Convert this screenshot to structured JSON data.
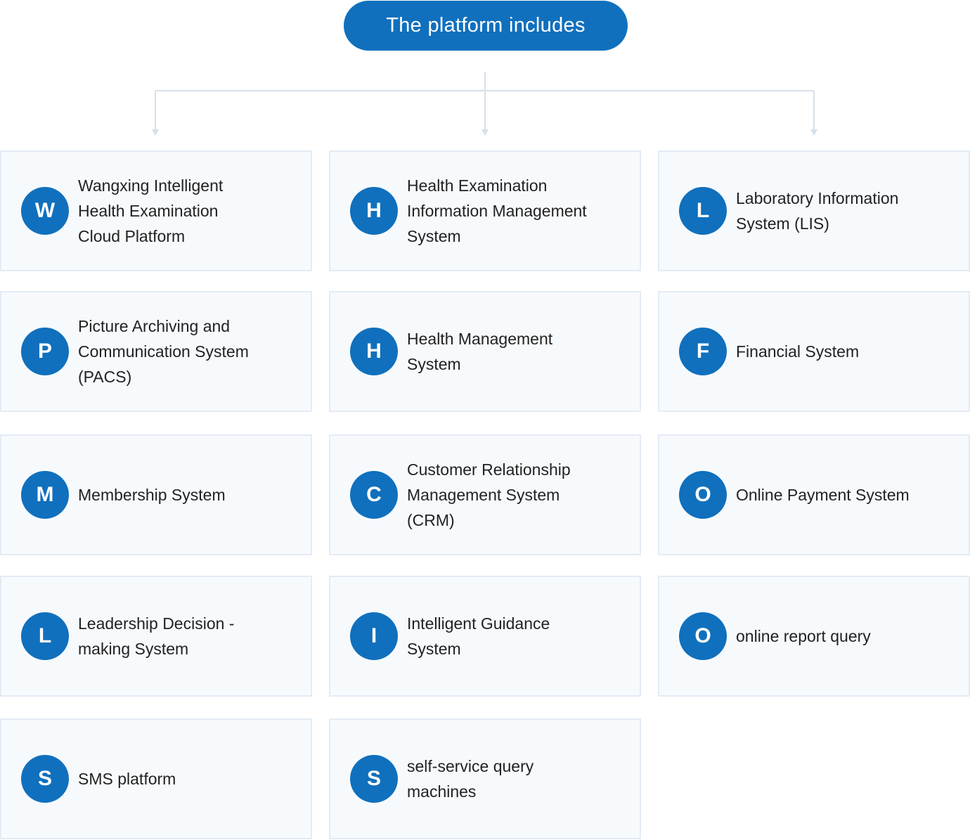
{
  "header": {
    "title": "The platform includes"
  },
  "colors": {
    "accent": "#1070bd",
    "card_bg": "#f7fafd",
    "card_border": "#e3ecf5",
    "connector": "#d5e0ea",
    "text": "#222222"
  },
  "systems": [
    {
      "initial": "W",
      "label": "Wangxing Intelligent Health Examination Cloud Platform"
    },
    {
      "initial": "H",
      "label": "Health Examination Information Management System"
    },
    {
      "initial": "L",
      "label": "Laboratory Information System (LIS)"
    },
    {
      "initial": "P",
      "label": "Picture Archiving and Communication System (PACS)"
    },
    {
      "initial": "H",
      "label": "Health Management System"
    },
    {
      "initial": "F",
      "label": "Financial System"
    },
    {
      "initial": "M",
      "label": "Membership System"
    },
    {
      "initial": "C",
      "label": "Customer Relationship Management System (CRM)"
    },
    {
      "initial": "O",
      "label": "Online Payment System"
    },
    {
      "initial": "L",
      "label": "Leadership Decision -making System"
    },
    {
      "initial": "I",
      "label": "Intelligent Guidance System"
    },
    {
      "initial": "O",
      "label": "online report query"
    },
    {
      "initial": "S",
      "label": "SMS platform"
    },
    {
      "initial": "S",
      "label": "self-service query machines"
    }
  ]
}
